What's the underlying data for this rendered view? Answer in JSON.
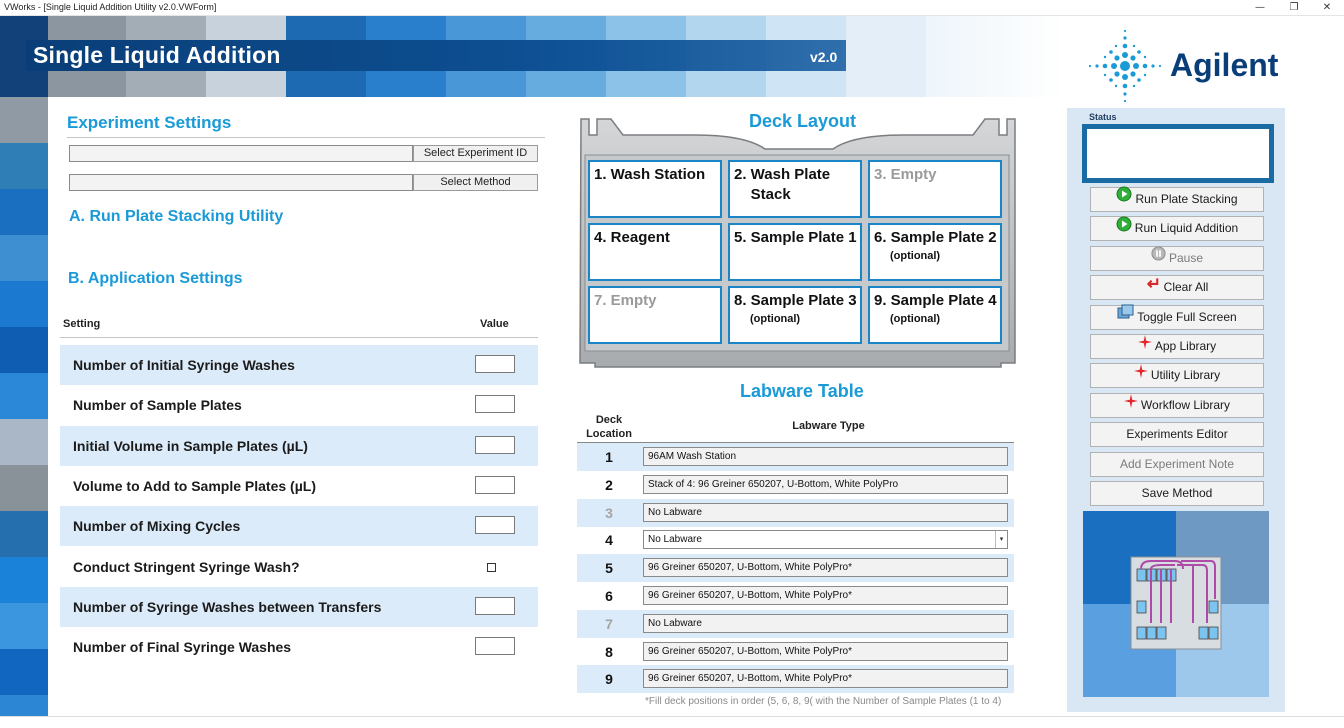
{
  "window": {
    "title": "VWorks - [Single Liquid Addition Utility v2.0.VWForm]",
    "minimize": "—",
    "maximize": "❐",
    "close": "✕"
  },
  "header": {
    "app_title": "Single Liquid Addition",
    "version": "v2.0",
    "brand": "Agilent"
  },
  "experiment": {
    "heading": "Experiment Settings",
    "experiment_id_value": "",
    "select_experiment_label": "Select Experiment ID",
    "method_value": "",
    "select_method_label": "Select Method"
  },
  "section_a": {
    "heading": "A. Run Plate Stacking Utility"
  },
  "section_b": {
    "heading": "B. Application Settings",
    "col_setting": "Setting",
    "col_value": "Value",
    "rows": [
      {
        "label": "Number of Initial Syringe Washes",
        "type": "input",
        "value": ""
      },
      {
        "label": "Number of Sample Plates",
        "type": "input",
        "value": ""
      },
      {
        "label": "Initial Volume in Sample Plates (µL)",
        "type": "input",
        "value": ""
      },
      {
        "label": "Volume to Add to Sample Plates (µL)",
        "type": "input",
        "value": ""
      },
      {
        "label": "Number of Mixing Cycles",
        "type": "input",
        "value": ""
      },
      {
        "label": "Conduct Stringent Syringe Wash?",
        "type": "checkbox",
        "value": "unchecked"
      },
      {
        "label": "Number of Syringe Washes between Transfers",
        "type": "input",
        "value": ""
      },
      {
        "label": "Number of Final Syringe Washes",
        "type": "input",
        "value": ""
      }
    ]
  },
  "deck": {
    "heading": "Deck Layout",
    "cells": [
      {
        "name": "1. Wash Station",
        "opt": "",
        "dim": false
      },
      {
        "name": "2. Wash Plate\n    Stack",
        "opt": "",
        "dim": false
      },
      {
        "name": "3. Empty",
        "opt": "",
        "dim": true
      },
      {
        "name": "4. Reagent",
        "opt": "",
        "dim": false
      },
      {
        "name": "5. Sample Plate 1",
        "opt": "",
        "dim": false
      },
      {
        "name": "6. Sample Plate 2",
        "opt": "(optional)",
        "dim": false
      },
      {
        "name": "7. Empty",
        "opt": "",
        "dim": true
      },
      {
        "name": "8. Sample Plate 3",
        "opt": "(optional)",
        "dim": false
      },
      {
        "name": "9. Sample Plate 4",
        "opt": "(optional)",
        "dim": false
      }
    ]
  },
  "labware": {
    "heading": "Labware Table",
    "col_location": "Deck\nLocation",
    "col_type": "Labware Type",
    "rows": [
      {
        "loc": "1",
        "type": "96AM Wash Station",
        "dim": false,
        "editable": false
      },
      {
        "loc": "2",
        "type": "Stack of 4: 96 Greiner 650207, U-Bottom, White PolyPro",
        "dim": false,
        "editable": false
      },
      {
        "loc": "3",
        "type": "No Labware",
        "dim": true,
        "editable": false
      },
      {
        "loc": "4",
        "type": "No Labware",
        "dim": false,
        "editable": true
      },
      {
        "loc": "5",
        "type": "96 Greiner 650207, U-Bottom, White PolyPro*",
        "dim": false,
        "editable": false
      },
      {
        "loc": "6",
        "type": "96 Greiner 650207, U-Bottom, White PolyPro*",
        "dim": false,
        "editable": false
      },
      {
        "loc": "7",
        "type": "No Labware",
        "dim": true,
        "editable": false
      },
      {
        "loc": "8",
        "type": "96 Greiner 650207, U-Bottom, White PolyPro*",
        "dim": false,
        "editable": false
      },
      {
        "loc": "9",
        "type": "96 Greiner 650207, U-Bottom, White PolyPro*",
        "dim": false,
        "editable": false
      }
    ],
    "footnote": "*Fill deck positions in order (5, 6, 8, 9( with the Number of Sample Plates (1 to 4)"
  },
  "status": {
    "label": "Status",
    "text": ""
  },
  "buttons": [
    {
      "label": "Run Plate Stacking",
      "icon": "play-icon",
      "disabled": false
    },
    {
      "label": "Run Liquid Addition",
      "icon": "play-icon",
      "disabled": false
    },
    {
      "label": "Pause",
      "icon": "pause-icon",
      "disabled": true
    },
    {
      "label": "Clear All",
      "icon": "return-arrow-icon",
      "disabled": false
    },
    {
      "label": "Toggle Full Screen",
      "icon": "windows-icon",
      "disabled": false
    },
    {
      "label": "App Library",
      "icon": "sparkle-icon",
      "disabled": false
    },
    {
      "label": "Utility Library",
      "icon": "sparkle-icon",
      "disabled": false
    },
    {
      "label": "Workflow Library",
      "icon": "sparkle-icon",
      "disabled": false
    },
    {
      "label": "Experiments Editor",
      "icon": "",
      "disabled": false
    },
    {
      "label": "Add Experiment Note",
      "icon": "",
      "disabled": true
    },
    {
      "label": "Save Method",
      "icon": "",
      "disabled": false
    }
  ],
  "colors": {
    "accent_heading": "#1a9ad6",
    "banner_dark": "#0a3e78",
    "cell_border": "#1a86c8",
    "row_shade": "#dcebf9",
    "panel_bg": "#d9e7f5"
  }
}
